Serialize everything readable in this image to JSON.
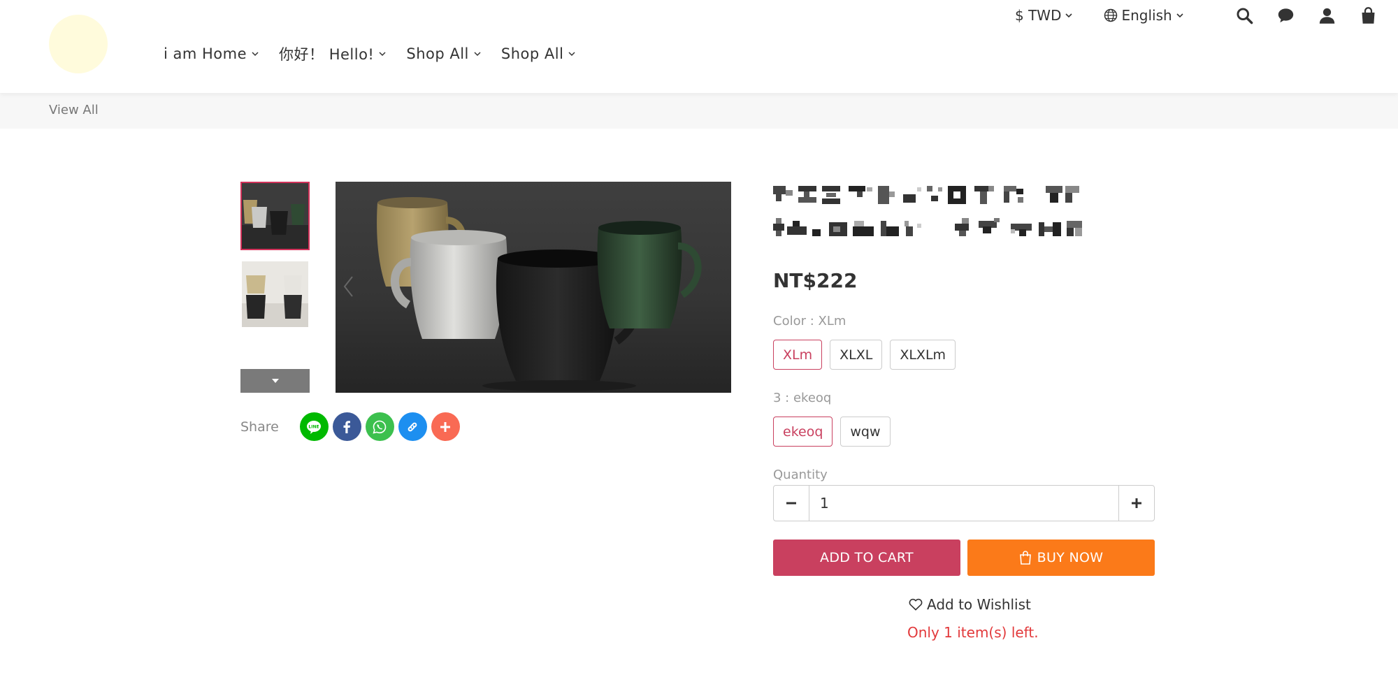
{
  "header": {
    "nav": [
      {
        "label": "i am Home"
      },
      {
        "label": "你好！ Hello!"
      },
      {
        "label": "Shop All"
      },
      {
        "label": "Shop All"
      }
    ],
    "currency": "$ TWD",
    "language": "English",
    "icons": [
      "search-icon",
      "chat-icon",
      "user-icon",
      "cart-bag-icon"
    ]
  },
  "breadcrumb": {
    "label": "View All"
  },
  "gallery": {
    "thumbnails": 2,
    "active_index": 0
  },
  "share": {
    "label": "Share",
    "buttons": [
      {
        "name": "line",
        "color": "#00b900"
      },
      {
        "name": "facebook",
        "color": "#3b5998"
      },
      {
        "name": "whatsapp",
        "color": "#3cc04e"
      },
      {
        "name": "copy-link",
        "color": "#1d8ff0"
      },
      {
        "name": "more",
        "color": "#f96a54"
      }
    ]
  },
  "product": {
    "price": "NT$222",
    "color_label": "Color : XLm",
    "color_options": [
      "XLm",
      "XLXL",
      "XLXLm"
    ],
    "color_selected": "XLm",
    "option3_label": "3 : ekeoq",
    "option3_options": [
      "ekeoq",
      "wqw"
    ],
    "option3_selected": "ekeoq",
    "quantity_label": "Quantity",
    "quantity": "1",
    "add_to_cart": "ADD TO CART",
    "buy_now": "BUY NOW",
    "wishlist": "Add to Wishlist",
    "stock_note": "Only 1 item(s) left."
  },
  "colors": {
    "accent": "#c9405f",
    "buy": "#fb7a19",
    "stock": "#e2393b"
  }
}
